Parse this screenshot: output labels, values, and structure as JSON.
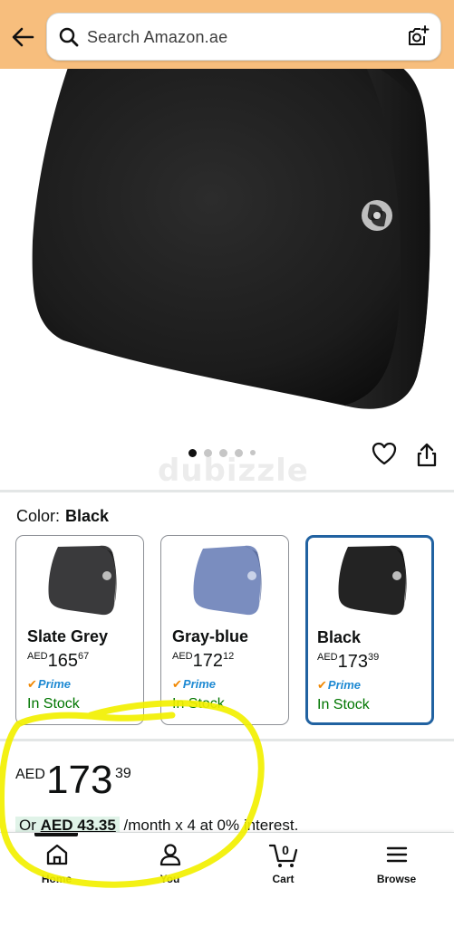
{
  "header": {
    "search_placeholder": "Search Amazon.ae"
  },
  "product": {
    "image_dots": 5,
    "active_dot": 0,
    "watermark": "dubizzle"
  },
  "color": {
    "label": "Color:",
    "selected": "Black"
  },
  "variants": [
    {
      "name": "Slate Grey",
      "currency": "AED",
      "whole": "165",
      "cents": "67",
      "prime": "Prime",
      "stock": "In Stock",
      "swatch_color": "#3a3a3c",
      "selected": false
    },
    {
      "name": "Gray-blue",
      "currency": "AED",
      "whole": "172",
      "cents": "12",
      "prime": "Prime",
      "stock": "In Stock",
      "swatch_color": "#7a8dbf",
      "selected": false
    },
    {
      "name": "Black",
      "currency": "AED",
      "whole": "173",
      "cents": "39",
      "prime": "Prime",
      "stock": "In Stock",
      "swatch_color": "#232323",
      "selected": true
    }
  ],
  "price": {
    "currency": "AED",
    "whole": "173",
    "cents": "39"
  },
  "installment": {
    "prefix": "Or",
    "amount": "AED 43.35",
    "suffix": "/month x 4 at 0% interest."
  },
  "bottom_nav": {
    "items": [
      {
        "label": "Home",
        "icon": "home-icon",
        "active": true
      },
      {
        "label": "You",
        "icon": "person-icon",
        "active": false
      },
      {
        "label": "Cart",
        "icon": "cart-icon",
        "active": false,
        "count": "0"
      },
      {
        "label": "Browse",
        "icon": "menu-icon",
        "active": false
      }
    ]
  },
  "colors": {
    "header_bg": "#f7be7d",
    "selected_border": "#2162a1",
    "prime_blue": "#1f8ad3",
    "in_stock_green": "#007600",
    "annotation_yellow": "#f5f500"
  }
}
